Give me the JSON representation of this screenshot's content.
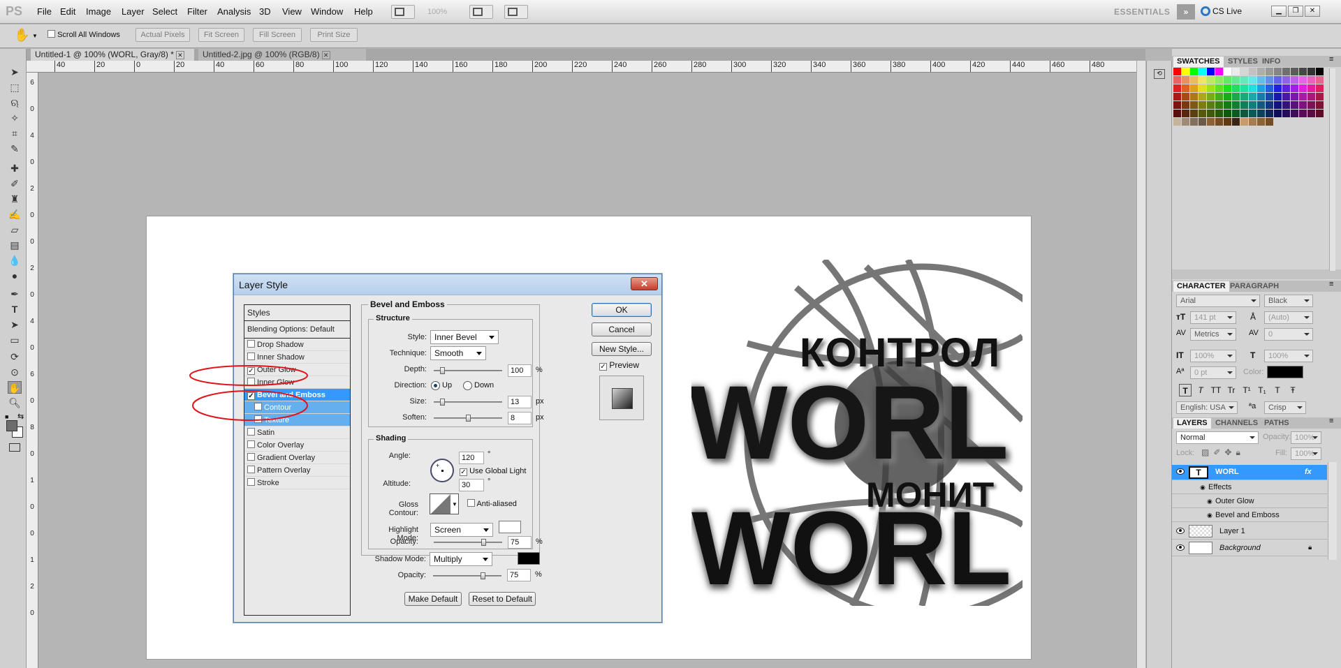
{
  "app": {
    "logo": "PS"
  },
  "menu": [
    "File",
    "Edit",
    "Image",
    "Layer",
    "Select",
    "Filter",
    "Analysis",
    "3D",
    "View",
    "Window",
    "Help"
  ],
  "menubar": {
    "zoom": "100%",
    "workspace": "ESSENTIALS",
    "cs_live": "CS Live"
  },
  "options_bar": {
    "scroll_all_windows": "Scroll All Windows",
    "buttons": [
      "Actual Pixels",
      "Fit Screen",
      "Fill Screen",
      "Print Size"
    ]
  },
  "tabs": [
    {
      "title": "Untitled-1 @ 100% (WORL, Gray/8) *",
      "active": true
    },
    {
      "title": "Untitled-2.jpg @ 100% (RGB/8)",
      "active": false
    }
  ],
  "ruler_h": [
    "40",
    "20",
    "0",
    "20",
    "40",
    "60",
    "80",
    "100",
    "120",
    "140",
    "160",
    "180",
    "200",
    "220",
    "240",
    "260",
    "280",
    "300",
    "320",
    "340",
    "360",
    "380",
    "400",
    "420",
    "440",
    "460",
    "480"
  ],
  "ruler_v": [
    "6",
    "0",
    "4",
    "0",
    "2",
    "0",
    "0",
    "2",
    "0",
    "4",
    "0",
    "6",
    "0",
    "8",
    "0",
    "1",
    "0",
    "0",
    "1",
    "2",
    "0"
  ],
  "canvas_text": {
    "line1": "КОНТРОЛ",
    "line2": "WORL",
    "line3": "МОНИТ",
    "line4": "WORL"
  },
  "dialog": {
    "title": "Layer Style",
    "styles_header": "Styles",
    "blending": "Blending Options: Default",
    "items": [
      {
        "label": "Drop Shadow",
        "checked": false
      },
      {
        "label": "Inner Shadow",
        "checked": false
      },
      {
        "label": "Outer Glow",
        "checked": true
      },
      {
        "label": "Inner Glow",
        "checked": false
      },
      {
        "label": "Bevel and Emboss",
        "checked": true
      },
      {
        "label": "Contour",
        "checked": false
      },
      {
        "label": "Texture",
        "checked": false
      },
      {
        "label": "Satin",
        "checked": false
      },
      {
        "label": "Color Overlay",
        "checked": false
      },
      {
        "label": "Gradient Overlay",
        "checked": false
      },
      {
        "label": "Pattern Overlay",
        "checked": false
      },
      {
        "label": "Stroke",
        "checked": false
      }
    ],
    "bevel_title": "Bevel and Emboss",
    "structure_title": "Structure",
    "style_label": "Style:",
    "style_value": "Inner Bevel",
    "technique_label": "Technique:",
    "technique_value": "Smooth",
    "depth_label": "Depth:",
    "depth_value": "100",
    "depth_unit": "%",
    "depth_pos": 0.1,
    "direction_label": "Direction:",
    "direction_up": "Up",
    "direction_down": "Down",
    "size_label": "Size:",
    "size_value": "13",
    "size_unit": "px",
    "size_pos": 0.1,
    "soften_label": "Soften:",
    "soften_value": "8",
    "soften_unit": "px",
    "soften_pos": 0.5,
    "shading_title": "Shading",
    "angle_label": "Angle:",
    "angle_value": "120",
    "angle_unit": "°",
    "global_light": "Use Global Light",
    "altitude_label": "Altitude:",
    "altitude_value": "30",
    "altitude_unit": "°",
    "gloss_label": "Gloss Contour:",
    "anti_aliased": "Anti-aliased",
    "highlight_label": "Highlight Mode:",
    "highlight_value": "Screen",
    "opacity_label": "Opacity:",
    "hl_opacity": "75",
    "hl_opacity_pos": 0.75,
    "pct": "%",
    "shadow_label": "Shadow Mode:",
    "shadow_value": "Multiply",
    "sh_opacity": "75",
    "sh_opacity_pos": 0.75,
    "make_default": "Make Default",
    "reset_default": "Reset to Default",
    "ok": "OK",
    "cancel": "Cancel",
    "new_style": "New Style...",
    "preview": "Preview",
    "highlight_color": "#ffffff",
    "shadow_color": "#000000"
  },
  "swatch_tabs": [
    "SWATCHES",
    "STYLES",
    "INFO"
  ],
  "character": {
    "tabs": [
      "CHARACTER",
      "PARAGRAPH"
    ],
    "font": "Arial",
    "weight": "Black",
    "size": "141 pt",
    "leading": "(Auto)",
    "kerning": "Metrics",
    "tracking": "0",
    "vscale": "100%",
    "hscale": "100%",
    "baseline": "0 pt",
    "color_label": "Color:",
    "language": "English: USA",
    "aa": "Crisp",
    "type_buttons": [
      "T",
      "T",
      "TT",
      "Tr",
      "T¹",
      "T₁",
      "T",
      "Ŧ"
    ]
  },
  "layers": {
    "tabs": [
      "LAYERS",
      "CHANNELS",
      "PATHS"
    ],
    "mode": "Normal",
    "opacity_label": "Opacity:",
    "opacity": "100%",
    "lock_label": "Lock:",
    "fill_label": "Fill:",
    "fill": "100%",
    "items": [
      "WORL",
      "Effects",
      "Outer Glow",
      "Bevel and Emboss",
      "Layer 1",
      "Background"
    ]
  },
  "colors": {
    "accent": "#3399ff",
    "annotation": "#e0141b"
  }
}
